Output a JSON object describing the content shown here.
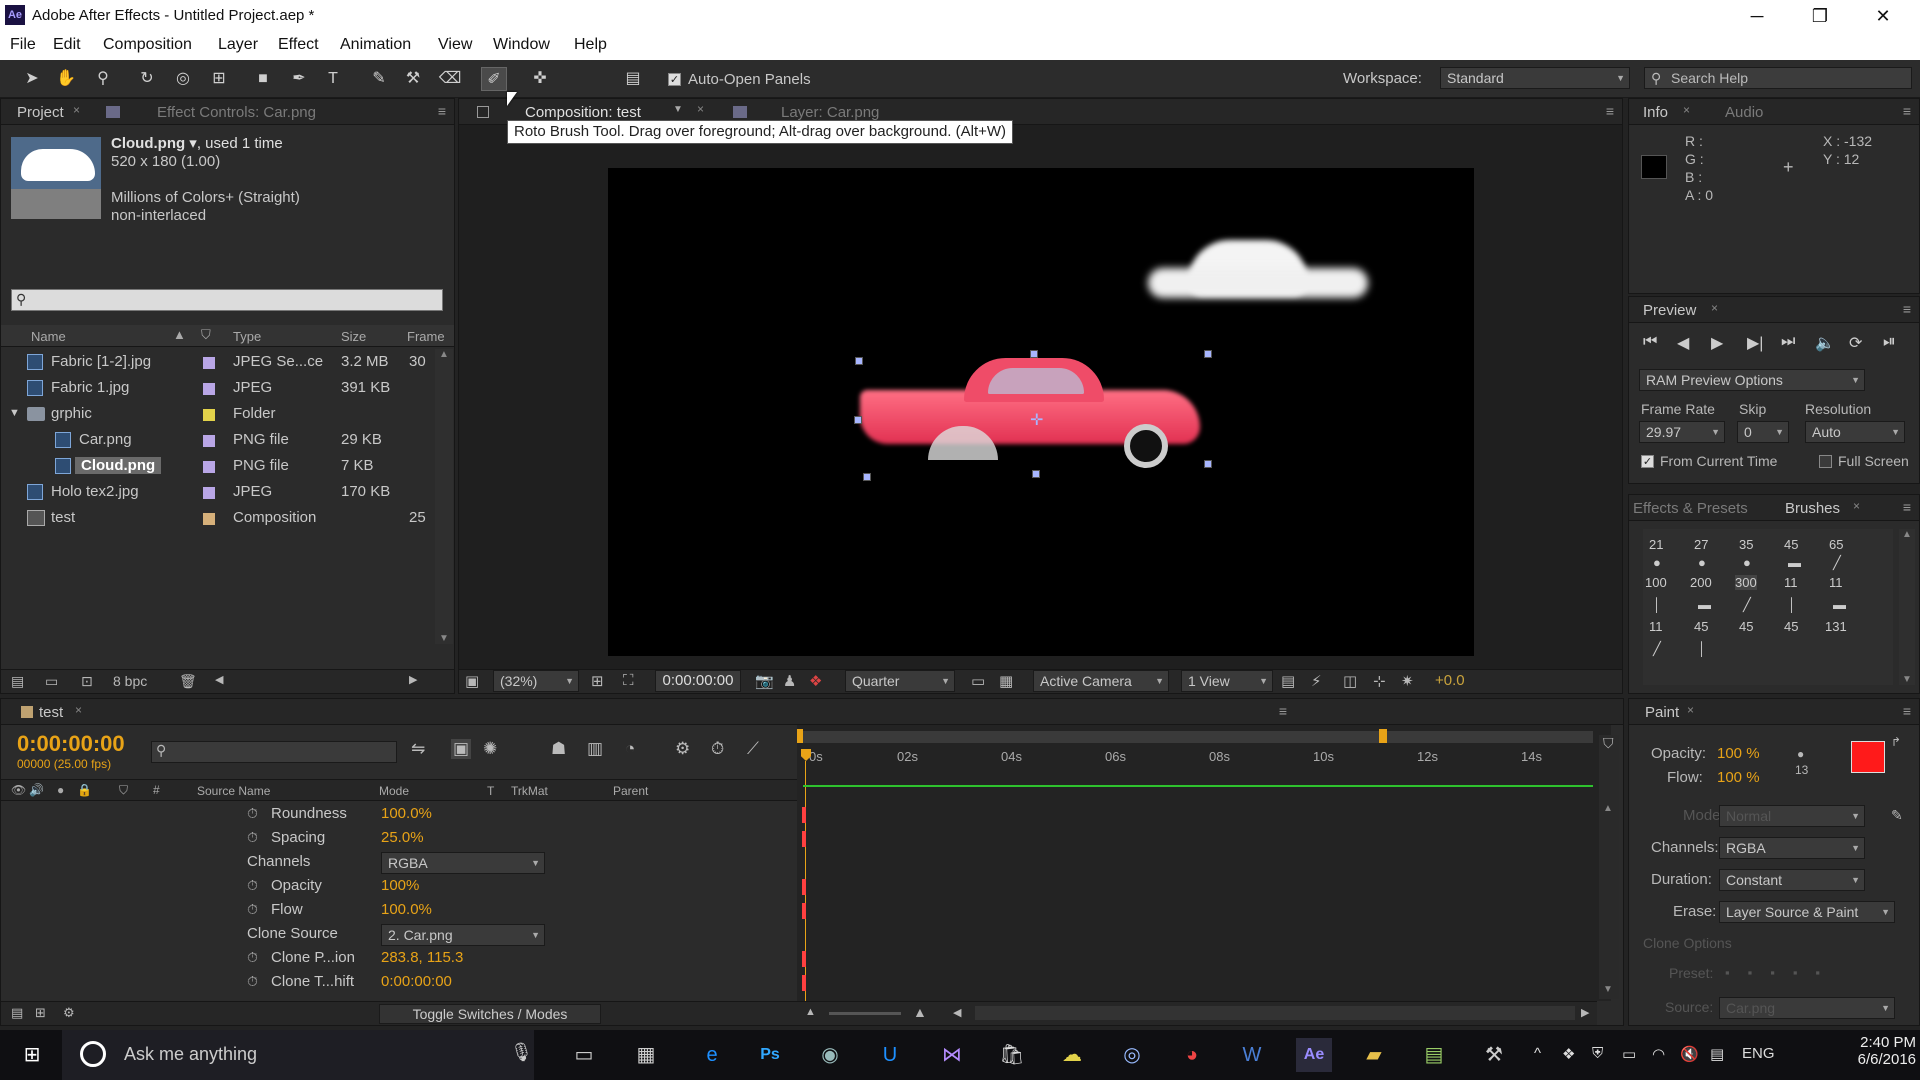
{
  "window": {
    "title": "Adobe After Effects - Untitled Project.aep *",
    "app_abbr": "Ae"
  },
  "menu": [
    "File",
    "Edit",
    "Composition",
    "Layer",
    "Effect",
    "Animation",
    "View",
    "Window",
    "Help"
  ],
  "toolbar": {
    "auto_open_label": "Auto-Open Panels",
    "workspace_label": "Workspace:",
    "workspace_value": "Standard",
    "search_placeholder": "Search Help",
    "tooltip": "Roto Brush Tool. Drag over foreground; Alt-drag over background. (Alt+W)"
  },
  "project": {
    "tab": "Project",
    "effect_controls_tab": "Effect Controls: Car.png",
    "selected_name": "Cloud.png ▾",
    "used": ", used 1 time",
    "dims": "520 x 180 (1.00)",
    "colors": "Millions of Colors+ (Straight)",
    "interlace": "non-interlaced",
    "headers": {
      "name": "Name",
      "type": "Type",
      "size": "Size",
      "frame": "Frame"
    },
    "items": [
      {
        "name": "Fabric [1-2].jpg",
        "type": "JPEG Se...ce",
        "size": "3.2 MB",
        "frame": "30",
        "label_color": "#b9a6e6"
      },
      {
        "name": "Fabric 1.jpg",
        "type": "JPEG",
        "size": "391 KB",
        "frame": "",
        "label_color": "#b9a6e6"
      },
      {
        "name": "grphic",
        "type": "Folder",
        "size": "",
        "frame": "",
        "label_color": "#e2d24a"
      },
      {
        "name": "Car.png",
        "type": "PNG file",
        "size": "29 KB",
        "frame": "",
        "label_color": "#b9a6e6"
      },
      {
        "name": "Cloud.png",
        "type": "PNG file",
        "size": "7 KB",
        "frame": "",
        "label_color": "#b9a6e6"
      },
      {
        "name": "Holo tex2.jpg",
        "type": "JPEG",
        "size": "170 KB",
        "frame": "",
        "label_color": "#b9a6e6"
      },
      {
        "name": "test",
        "type": "Composition",
        "size": "",
        "frame": "25",
        "label_color": "#d6b07a"
      }
    ],
    "bpc": "8 bpc"
  },
  "comp": {
    "tab": "Composition: test",
    "layer_tab": "Layer: Car.png",
    "zoom": "(32%)",
    "timecode": "0:00:00:00",
    "resolution": "Quarter",
    "camera": "Active Camera",
    "views": "1 View",
    "exposure": "+0.0"
  },
  "info": {
    "tab": "Info",
    "audio_tab": "Audio",
    "r": "R :",
    "g": "G :",
    "b": "B :",
    "a": "A : 0",
    "x": "X : -132",
    "y": "Y : 12"
  },
  "preview": {
    "tab": "Preview",
    "ram": "RAM Preview Options",
    "frame_rate_label": "Frame Rate",
    "skip_label": "Skip",
    "resolution_label": "Resolution",
    "frame_rate": "29.97",
    "skip": "0",
    "resolution": "Auto",
    "from_current": "From Current Time",
    "full_screen": "Full Screen"
  },
  "brushes": {
    "effects_tab": "Effects & Presets",
    "tab": "Brushes",
    "row1": [
      "21",
      "27",
      "35",
      "45",
      "65"
    ],
    "row2": [
      "100",
      "200",
      "300",
      "11",
      "11"
    ],
    "row3": [
      "11",
      "45",
      "45",
      "45",
      "131"
    ]
  },
  "timeline": {
    "tab": "test",
    "timecode": "0:00:00:00",
    "fps": "00000 (25.00 fps)",
    "headers": {
      "source": "Source Name",
      "mode": "Mode",
      "t": "T",
      "trkmat": "TrkMat",
      "parent": "Parent"
    },
    "ruler": [
      "0s",
      "02s",
      "04s",
      "06s",
      "08s",
      "10s",
      "12s",
      "14s"
    ],
    "props": [
      {
        "name": "Roundness",
        "value": "100.0%"
      },
      {
        "name": "Spacing",
        "value": "25.0%"
      },
      {
        "name": "Channels",
        "value": "RGBA"
      },
      {
        "name": "Opacity",
        "value": "100%"
      },
      {
        "name": "Flow",
        "value": "100.0%"
      },
      {
        "name": "Clone Source",
        "value": "2. Car.png"
      },
      {
        "name": "Clone P...ion",
        "value": "283.8, 115.3"
      },
      {
        "name": "Clone T...hift",
        "value": "0:00:00:00"
      }
    ],
    "toggle": "Toggle Switches / Modes"
  },
  "paint": {
    "tab": "Paint",
    "opacity_label": "Opacity:",
    "opacity": "100 %",
    "flow_label": "Flow:",
    "flow": "100 %",
    "brush_size": "13",
    "mode_label": "Mode:",
    "mode": "Normal",
    "channels_label": "Channels:",
    "channels": "RGBA",
    "duration_label": "Duration:",
    "duration": "Constant",
    "erase_label": "Erase:",
    "erase": "Layer Source & Paint",
    "clone_options": "Clone Options",
    "preset_label": "Preset:",
    "source_label": "Source:",
    "source": "Car.png",
    "fg_color": "#ff1a1a"
  },
  "taskbar": {
    "search": "Ask me anything",
    "lang": "ENG",
    "time": "2:40 PM",
    "date": "6/6/2016"
  }
}
